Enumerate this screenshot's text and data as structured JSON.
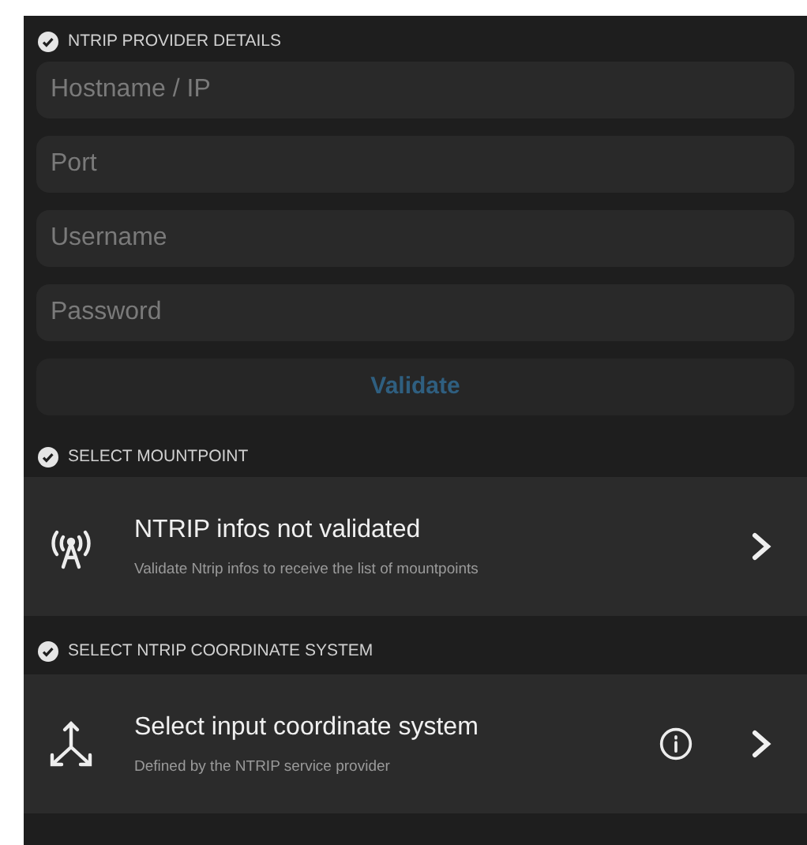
{
  "sections": [
    {
      "kind": "form",
      "header": "NTRIP PROVIDER DETAILS",
      "fields": [
        {
          "placeholder": "Hostname / IP"
        },
        {
          "placeholder": "Port"
        },
        {
          "placeholder": "Username"
        },
        {
          "placeholder": "Password"
        }
      ],
      "button": {
        "label": "Validate",
        "disabled": true
      }
    },
    {
      "kind": "list",
      "header": "SELECT MOUNTPOINT",
      "item": {
        "kind": "antenna",
        "title": "NTRIP infos not validated",
        "subtitle": "Validate Ntrip infos to receive the list of mountpoints",
        "info_button": false
      }
    },
    {
      "kind": "list",
      "header": "SELECT NTRIP COORDINATE SYSTEM",
      "item": {
        "kind": "axes",
        "title": "Select input coordinate system",
        "subtitle": "Defined by the NTRIP service provider",
        "info_button": true
      }
    }
  ]
}
